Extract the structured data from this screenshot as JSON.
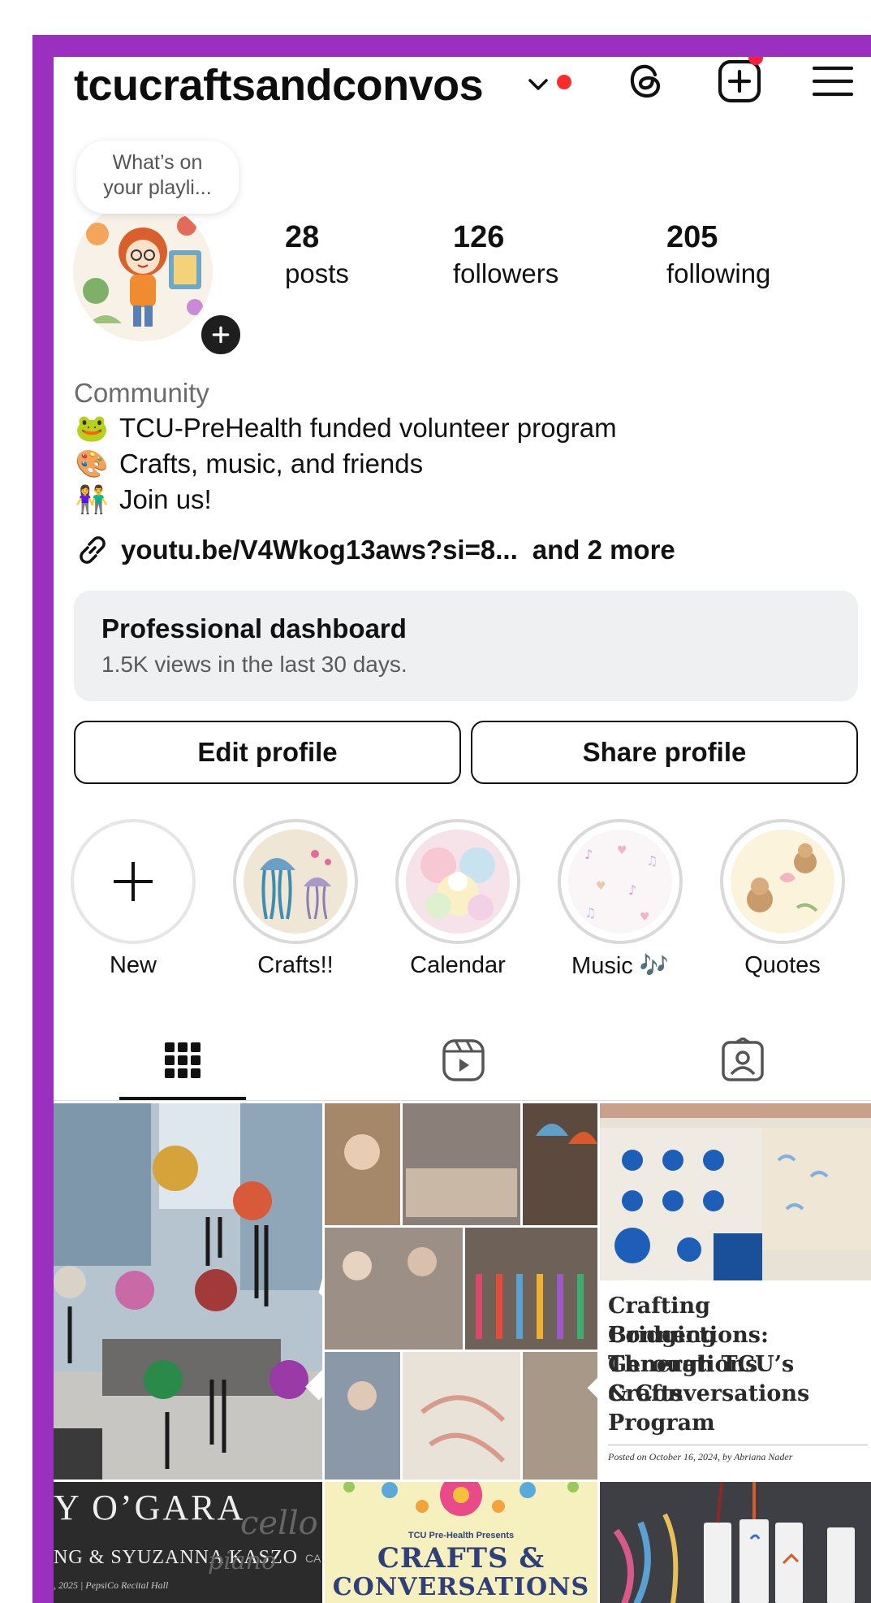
{
  "header": {
    "username": "tcucraftsandconvos",
    "icons": [
      "chevron-down-icon",
      "threads-icon",
      "new-post-icon",
      "menu-icon"
    ]
  },
  "note": {
    "text_line1": "What’s on",
    "text_line2": "your playli..."
  },
  "stats": [
    {
      "value": "28",
      "label": "posts"
    },
    {
      "value": "126",
      "label": "followers"
    },
    {
      "value": "205",
      "label": "following"
    }
  ],
  "bio": {
    "category": "Community",
    "lines": [
      {
        "emoji": "🐸",
        "text": "TCU-PreHealth funded volunteer program"
      },
      {
        "emoji": "🎨",
        "text": "Crafts, music, and friends"
      },
      {
        "emoji": "👫",
        "text": "Join us!"
      }
    ],
    "link_text": "youtu.be/V4Wkog13aws?si=8...",
    "link_more": "and 2 more"
  },
  "dashboard": {
    "title": "Professional dashboard",
    "subtitle": "1.5K views in the last 30 days."
  },
  "buttons": {
    "edit": "Edit profile",
    "share": "Share profile"
  },
  "highlights": [
    {
      "label": "New"
    },
    {
      "label": "Crafts!!"
    },
    {
      "label": "Calendar"
    },
    {
      "label": "Music 🎶"
    },
    {
      "label": "Quotes"
    }
  ],
  "tabs": [
    "grid-tab",
    "reels-tab",
    "tagged-tab"
  ],
  "posts": {
    "article_lines": [
      "Crafting Connections:",
      "Bridging Generations",
      "Through TCU’s Crafts",
      "& Conversations",
      "Program"
    ],
    "article_meta": "Posted on October 16, 2024, by Abriana Nader",
    "concert_line1": "Y O’GARA",
    "concert_script1": "cello",
    "concert_line2": "NG & SYUZANNA KASZO",
    "concert_script2": "piano",
    "concert_line3": ", 2025 | PepsiCo Recital Hall",
    "concert_ca": "CA",
    "flyer_small": "TCU Pre-Health Presents",
    "flyer_title": "CRAFTS &",
    "flyer_title2": "CONVERSATIONS"
  },
  "colors": {
    "frame": "#9a2fc0",
    "accent_red": "#ff2a2a",
    "dashboard_bg": "#eff0f2"
  }
}
